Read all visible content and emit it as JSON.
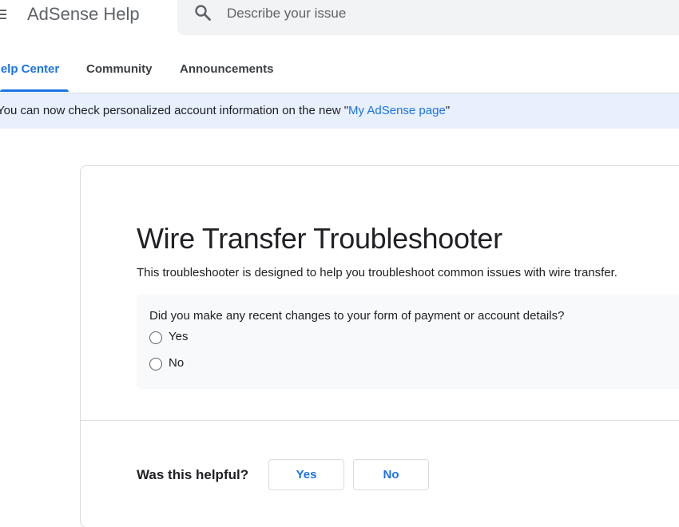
{
  "header": {
    "menu_icon": "menu-icon",
    "app_title": "AdSense Help",
    "search": {
      "icon": "search-icon",
      "placeholder": "Describe your issue",
      "value": ""
    }
  },
  "tabs": [
    {
      "label": "Help Center",
      "active": true
    },
    {
      "label": "Community",
      "active": false
    },
    {
      "label": "Announcements",
      "active": false
    }
  ],
  "banner": {
    "text_before": "You can now check personalized account information on the new \"",
    "link_text": "My AdSense page",
    "text_after": "\""
  },
  "main": {
    "title": "Wire Transfer Troubleshooter",
    "description": "This troubleshooter is designed to help you troubleshoot common issues with wire transfer.",
    "question": {
      "text": "Did you make any recent changes to your form of payment or account details?",
      "options": [
        "Yes",
        "No"
      ],
      "selected": null
    },
    "feedback": {
      "label": "Was this helpful?",
      "yes_label": "Yes",
      "no_label": "No"
    }
  },
  "colors": {
    "accent": "#1a73e8",
    "banner_bg": "#e8f0fe",
    "search_bg": "#f1f3f4",
    "question_bg": "#f8f9fa",
    "border": "#dadce0"
  }
}
